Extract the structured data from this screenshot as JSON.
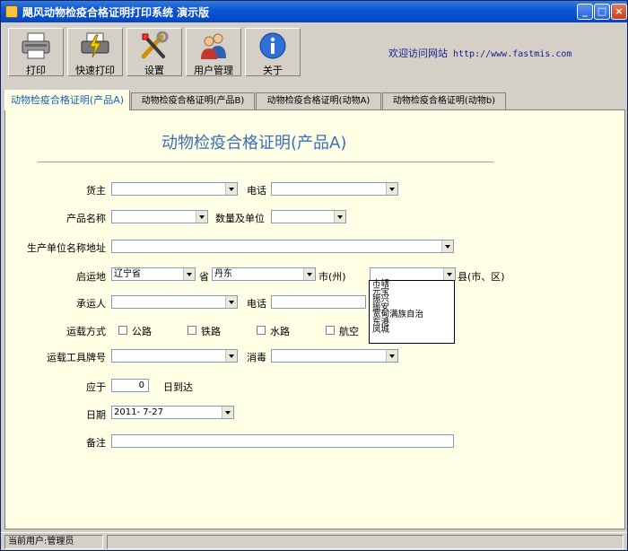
{
  "window": {
    "title": "飓风动物检疫合格证明打印系统 演示版",
    "controls": {
      "minimize": "_",
      "maximize": "□",
      "close": "×"
    }
  },
  "toolbar": {
    "print": "打印",
    "quick_print": "快速打印",
    "settings": "设置",
    "user_mgmt": "用户管理",
    "about": "关于",
    "website_text": "欢迎访问网站",
    "website_url": "http://www.fastmis.com"
  },
  "tabs": [
    {
      "label": "动物检疫合格证明(产品A)"
    },
    {
      "label": "动物检疫合格证明(产品B)"
    },
    {
      "label": "动物检疫合格证明(动物A)"
    },
    {
      "label": "动物检疫合格证明(动物b)"
    }
  ],
  "form": {
    "title": "动物检疫合格证明(产品A)",
    "owner_label": "货主",
    "owner_value": "",
    "phone_label": "电话",
    "phone_value": "",
    "product_label": "产品名称",
    "product_value": "",
    "quantity_label": "数量及单位",
    "quantity_value": "",
    "producer_label": "生产单位名称地址",
    "producer_value": "",
    "origin_label": "启运地",
    "province_value": "辽宁省",
    "province_unit": "省",
    "city_value": "丹东",
    "city_unit": "市(州)",
    "county_value": "",
    "county_unit": "县(市、区)",
    "county_options": [
      "市辖",
      "元宝",
      "振兴",
      "振安",
      "宽甸满族自治",
      "东港",
      "凤城"
    ],
    "carrier_label": "承运人",
    "carrier_value": "",
    "carrier_phone_label": "电话",
    "carrier_phone_value": "",
    "transport_label": "运载方式",
    "transport_options": [
      "公路",
      "铁路",
      "水路",
      "航空"
    ],
    "vehicle_label": "运载工具牌号",
    "vehicle_value": "",
    "disinfect_label": "消毒",
    "disinfect_value": "",
    "due_label": "应于",
    "due_value": "0",
    "due_suffix": "日到达",
    "date_label": "日期",
    "date_value": "2011- 7-27",
    "remarks_label": "备注",
    "remarks_value": ""
  },
  "status": {
    "current_user": "当前用户:管理员"
  }
}
